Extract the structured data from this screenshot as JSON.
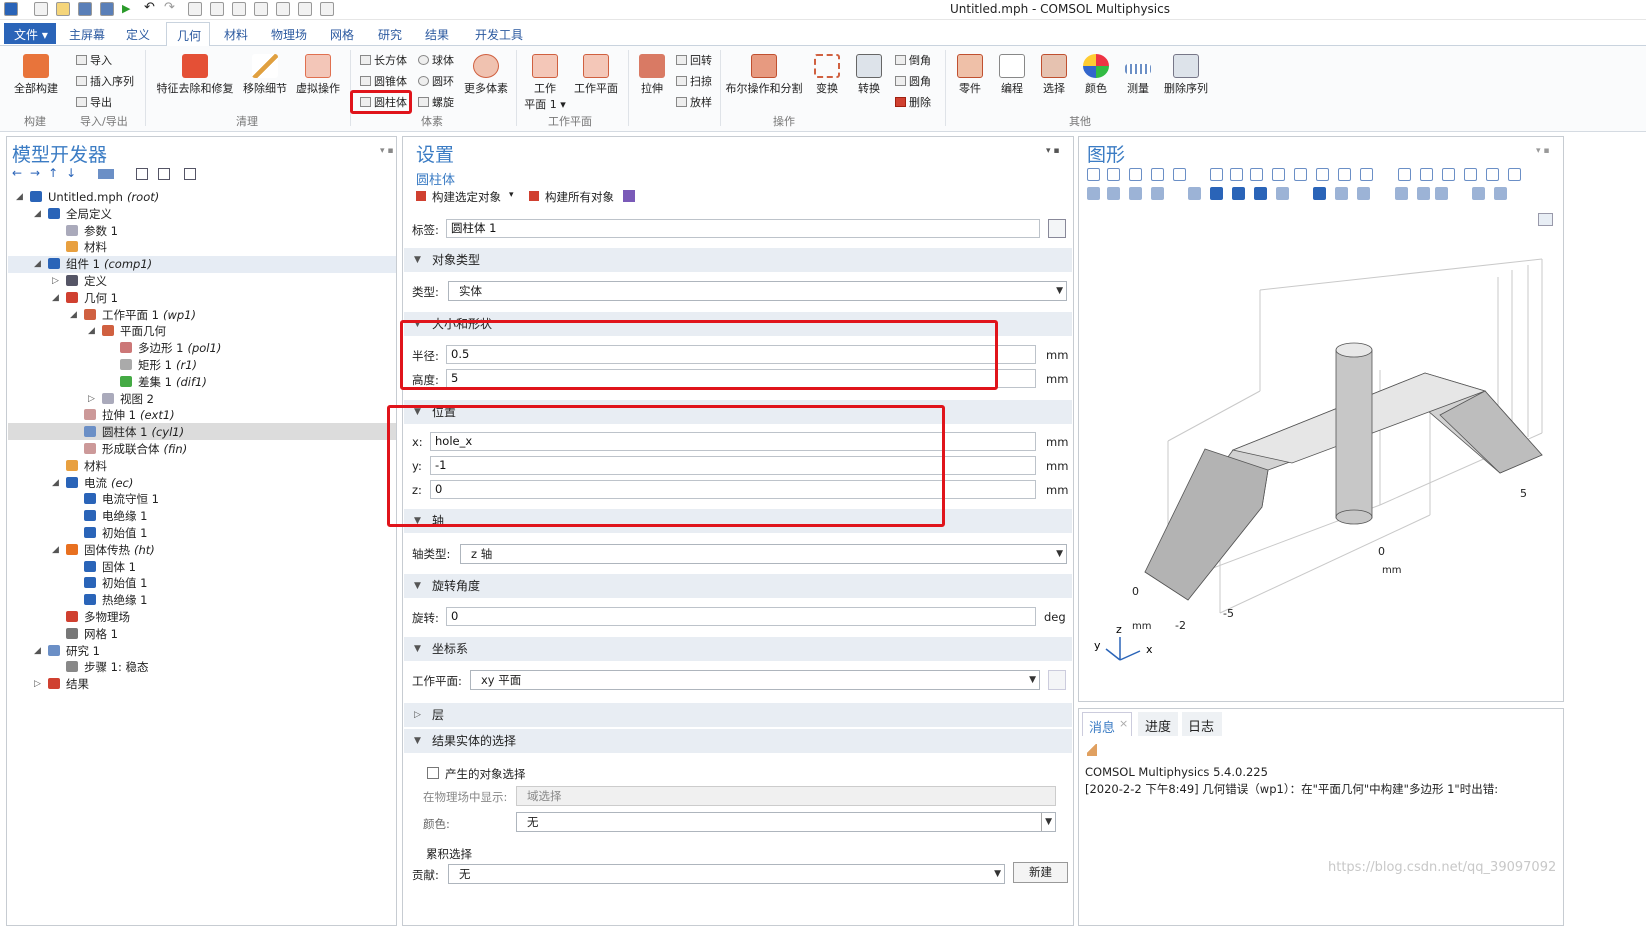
{
  "window": {
    "title": "Untitled.mph - COMSOL Multiphysics"
  },
  "tabs": {
    "file": "文件 ▾",
    "home": "主屏幕",
    "definitions": "定义",
    "geometry": "几何",
    "materials": "材料",
    "physics": "物理场",
    "mesh": "网格",
    "study": "研究",
    "results": "结果",
    "developer": "开发工具"
  },
  "ribbon": {
    "build_all": "全部构建",
    "import": "导入",
    "insert_sequence": "插入序列",
    "export": "导出",
    "defeaturing": "特征去除和修复",
    "remove_details": "移除细节",
    "virtual_ops": "虚拟操作",
    "block": "长方体",
    "sphere": "球体",
    "cone": "圆锥体",
    "torus": "圆环",
    "cylinder": "圆柱体",
    "helix": "螺旋",
    "more_primitives": "更多体素",
    "work_plane_a": "工作",
    "work_plane_b": "平面 1 ▾",
    "work_plane": "工作平面",
    "extrude": "拉伸",
    "revolve": "回转",
    "sweep": "扫掠",
    "loft": "放样",
    "boolean": "布尔操作和分割",
    "transforms": "变换",
    "conversions": "转换",
    "chamfer": "倒角",
    "fillet": "圆角",
    "delete": "删除",
    "parts": "零件",
    "programming": "编程",
    "selections": "选择",
    "colors": "颜色",
    "measure": "测量",
    "delete_sequence": "删除序列",
    "groups": {
      "build": "构建",
      "import_export": "导入/导出",
      "cleanup": "清理",
      "primitives": "体素",
      "workplane": "工作平面",
      "operations": "操作",
      "other": "其他"
    }
  },
  "model_builder": {
    "title": "模型开发器",
    "tree": [
      {
        "label": "Untitled.mph",
        "tag": "(root)",
        "arrow": "◢"
      },
      {
        "label": "全局定义",
        "tag": "",
        "arrow": "◢"
      },
      {
        "label": "参数 1",
        "tag": "",
        "arrow": ""
      },
      {
        "label": "材料",
        "tag": "",
        "arrow": ""
      },
      {
        "label": "组件 1",
        "tag": "(comp1)",
        "arrow": "◢"
      },
      {
        "label": "定义",
        "tag": "",
        "arrow": "▷"
      },
      {
        "label": "几何 1",
        "tag": "",
        "arrow": "◢"
      },
      {
        "label": "工作平面 1",
        "tag": "(wp1)",
        "arrow": "◢"
      },
      {
        "label": "平面几何",
        "tag": "",
        "arrow": "◢"
      },
      {
        "label": "多边形 1",
        "tag": "(pol1)",
        "arrow": ""
      },
      {
        "label": "矩形 1",
        "tag": "(r1)",
        "arrow": ""
      },
      {
        "label": "差集 1",
        "tag": "(dif1)",
        "arrow": ""
      },
      {
        "label": "视图 2",
        "tag": "",
        "arrow": "▷"
      },
      {
        "label": "拉伸 1",
        "tag": "(ext1)",
        "arrow": ""
      },
      {
        "label": "圆柱体 1",
        "tag": "(cyl1)",
        "arrow": ""
      },
      {
        "label": "形成联合体",
        "tag": "(fin)",
        "arrow": ""
      },
      {
        "label": "材料",
        "tag": "",
        "arrow": ""
      },
      {
        "label": "电流",
        "tag": "(ec)",
        "arrow": "◢"
      },
      {
        "label": "电流守恒 1",
        "tag": "",
        "arrow": ""
      },
      {
        "label": "电绝缘 1",
        "tag": "",
        "arrow": ""
      },
      {
        "label": "初始值 1",
        "tag": "",
        "arrow": ""
      },
      {
        "label": "固体传热",
        "tag": "(ht)",
        "arrow": "◢"
      },
      {
        "label": "固体 1",
        "tag": "",
        "arrow": ""
      },
      {
        "label": "初始值 1",
        "tag": "",
        "arrow": ""
      },
      {
        "label": "热绝缘 1",
        "tag": "",
        "arrow": ""
      },
      {
        "label": "多物理场",
        "tag": "",
        "arrow": ""
      },
      {
        "label": "网格 1",
        "tag": "",
        "arrow": ""
      },
      {
        "label": "研究 1",
        "tag": "",
        "arrow": "◢"
      },
      {
        "label": "步骤 1: 稳态",
        "tag": "",
        "arrow": ""
      },
      {
        "label": "结果",
        "tag": "",
        "arrow": "▷"
      }
    ]
  },
  "settings": {
    "title": "设置",
    "subtitle": "圆柱体",
    "build_selected": "构建选定对象",
    "build_all": "构建所有对象",
    "label_label": "标签:",
    "label_value": "圆柱体 1",
    "object_type": {
      "header": "对象类型",
      "type_label": "类型:",
      "type_value": "实体"
    },
    "size_shape": {
      "header": "大小和形状",
      "radius_label": "半径:",
      "radius": "0.5",
      "height_label": "高度:",
      "height": "5",
      "unit": "mm"
    },
    "position": {
      "header": "位置",
      "x_label": "x:",
      "x": "hole_x",
      "y_label": "y:",
      "y": "-1",
      "z_label": "z:",
      "z": "0",
      "unit": "mm"
    },
    "axis": {
      "header": "轴",
      "type_label": "轴类型:",
      "type_value": "z 轴"
    },
    "rotation": {
      "header": "旋转角度",
      "label": "旋转:",
      "value": "0",
      "unit": "deg"
    },
    "coord": {
      "header": "坐标系",
      "wp_label": "工作平面:",
      "wp_value": "xy 平面"
    },
    "layers": {
      "header": "层"
    },
    "selections": {
      "header": "结果实体的选择",
      "checkbox": "产生的对象选择",
      "show_label": "在物理场中显示:",
      "show_value": "域选择",
      "color_label": "颜色:",
      "color_value": "无",
      "cumulative": "累积选择",
      "contrib_label": "贡献:",
      "contrib_value": "无",
      "new_btn": "新建"
    }
  },
  "graphics": {
    "title": "图形",
    "axis_labels": {
      "five_right": "5",
      "zero_mid": "0",
      "mm_mid": "mm",
      "minus5": "-5",
      "minus2": "-2",
      "zero_left": "0",
      "mm_left": "mm",
      "z": "z",
      "y": "y",
      "x": "x"
    }
  },
  "messages": {
    "tab_messages": "消息",
    "tab_progress": "进度",
    "tab_log": "日志",
    "line1": "COMSOL Multiphysics 5.4.0.225",
    "line2": "[2020-2-2 下午8:49] 几何错误（wp1）：在\"平面几何\"中构建\"多边形 1\"时出错:"
  },
  "watermark": "https://blog.csdn.net/qq_39097092"
}
